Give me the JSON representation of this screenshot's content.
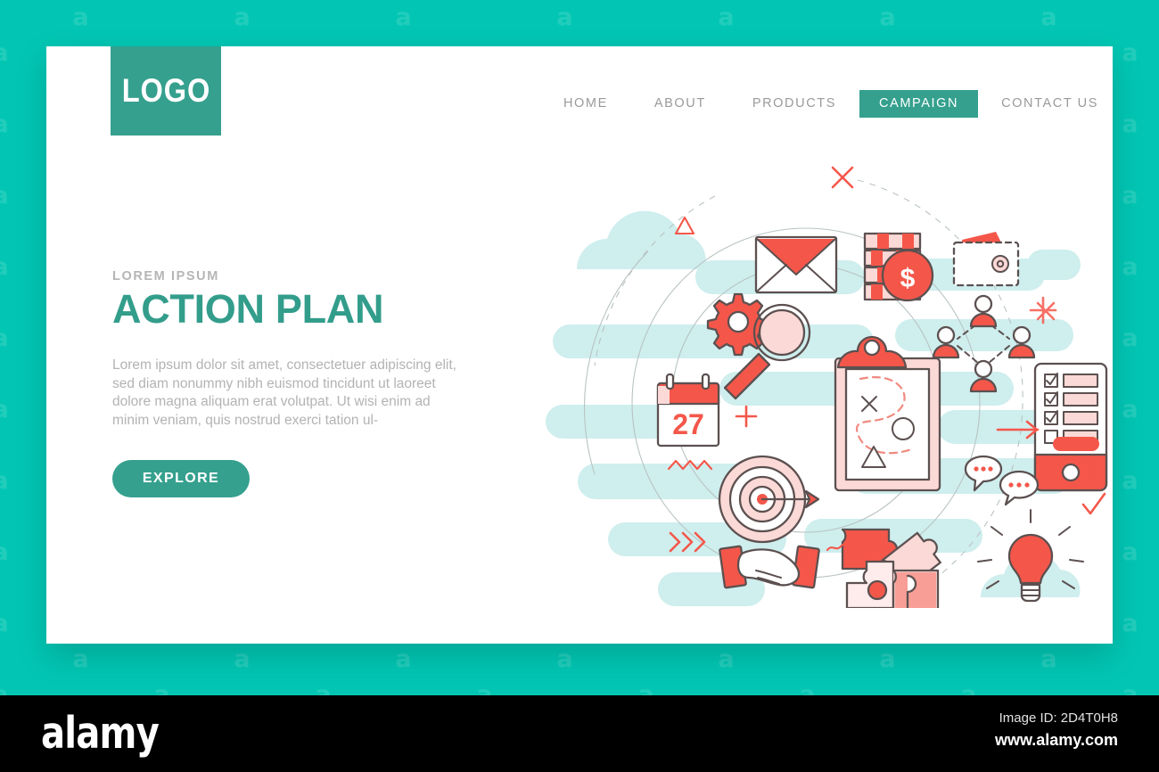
{
  "theme": {
    "page_background": "#02c6b3",
    "card_background": "#ffffff",
    "brand_teal": "#35a08e",
    "heading_teal": "#339d8b",
    "accent_coral": "#f4574a",
    "accent_coral_light": "#f9d2cf",
    "mint_shape": "#cfeeee",
    "muted_text": "#b3b3b3",
    "nav_text": "#9a9a9a",
    "outline_stroke": "#5c5050"
  },
  "watermark": {
    "glyph": "a",
    "note": "faint repeating alamy mark on teal backdrop"
  },
  "header": {
    "logo_label": "LOGO",
    "nav": [
      {
        "label": "HOME",
        "active": false
      },
      {
        "label": "ABOUT",
        "active": false
      },
      {
        "label": "PRODUCTS",
        "active": false
      },
      {
        "label": "CAMPAIGN",
        "active": true
      },
      {
        "label": "CONTACT US",
        "active": false
      }
    ]
  },
  "hero": {
    "eyebrow": "LOREM IPSUM",
    "headline": "ACTION PLAN",
    "body": "Lorem ipsum dolor sit amet, consectetuer adipiscing elit, sed diam nonummy nibh euismod tincidunt ut laoreet dolore magna aliquam erat volutpat. Ut wisi enim ad minim veniam, quis nostrud exerci tation ul-",
    "cta_label": "EXPLORE"
  },
  "illustration": {
    "title": "action plan concept illustration",
    "center_icon": "clipboard-strategy-icon",
    "clipboard_markers": [
      "x-marker",
      "circle-marker",
      "triangle-marker"
    ],
    "calendar_day": "27",
    "coin_symbol": "$",
    "phone_checklist": {
      "checked": 3,
      "unchecked": 1
    },
    "icons": [
      "envelope-icon",
      "gear-icon",
      "magnifier-icon",
      "coin-stack-icon",
      "wallet-icon",
      "team-network-icon",
      "phone-checklist-icon",
      "chat-bubbles-icon",
      "lightbulb-icon",
      "puzzle-pieces-icon",
      "handshake-icon",
      "target-arrow-icon",
      "calendar-icon"
    ],
    "doodles": [
      "x-mark",
      "triangle-outline",
      "plus-sign",
      "zigzag",
      "chevrons",
      "arrow-right",
      "checkmark",
      "tilde",
      "burst"
    ]
  },
  "footer": {
    "brand": "alamy",
    "image_id": "Image ID: 2D4T0H8",
    "url": "www.alamy.com"
  }
}
